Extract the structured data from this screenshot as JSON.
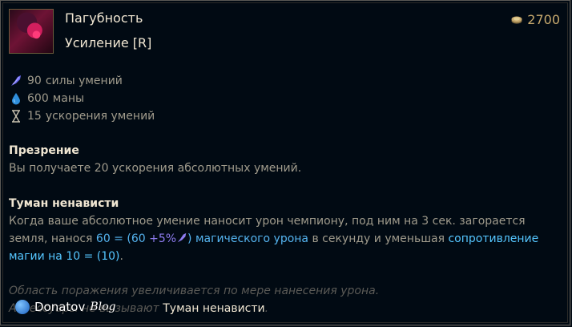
{
  "item": {
    "name": "Пагубность",
    "subtitle": "Усиление [R]",
    "cost": "2700",
    "icon": "item-portrait"
  },
  "stats": [
    {
      "value": "90",
      "label": "силы умений",
      "icon": "ability-power-icon"
    },
    {
      "value": "600",
      "label": "маны",
      "icon": "mana-drop-icon"
    },
    {
      "value": "15",
      "label": "ускорения умений",
      "icon": "hourglass-icon"
    }
  ],
  "passive1": {
    "title": "Презрение",
    "text": "Вы получаете 20 ускорения абсолютных умений."
  },
  "passive2": {
    "title": "Туман ненависти",
    "text_a": "Когда ваше абсолютное умение наносит урон чемпиону, под ним на 3 сек. загорается",
    "text_b": "земля, нанося ",
    "dmg_formula_a": "60 = (60 ",
    "dmg_ap": "+5%",
    "dmg_formula_b": ")",
    "dmg_type": " магического урона",
    "text_c": " в секунду и уменьшая ",
    "res_a": "сопротивление",
    "res_b": "магии на 10 = (10)",
    "text_d": "."
  },
  "flavor": {
    "line1": "Область поражения увеличивается по мере нанесения урона.",
    "line2_prefix": "Аксессуары не вызывают ",
    "line2_name": "Туман ненависти",
    "line2_suffix": "."
  },
  "watermark": {
    "name": "Donatov",
    "suffix": "Blog"
  },
  "colors": {
    "accent_gold": "#c8aa6e",
    "magic": "#55b4f0",
    "ability_power": "#8e7cf0"
  }
}
